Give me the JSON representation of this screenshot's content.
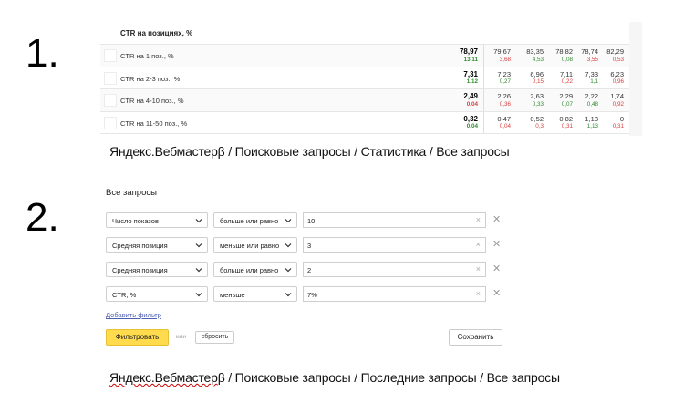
{
  "step_labels": [
    "1.",
    "2."
  ],
  "ctr_table": {
    "title": "CTR на позициях, %",
    "rows": [
      {
        "label": "CTR на 1 поз., %",
        "current": {
          "value": "78,97",
          "delta": "13,11",
          "dir": "up"
        },
        "history": [
          {
            "value": "79,67",
            "delta": "3,68",
            "dir": "down"
          },
          {
            "value": "83,35",
            "delta": "4,53",
            "dir": "up"
          },
          {
            "value": "78,82",
            "delta": "0,08",
            "dir": "up"
          },
          {
            "value": "78,74",
            "delta": "3,55",
            "dir": "down"
          },
          {
            "value": "82,29",
            "delta": "0,53",
            "dir": "down"
          }
        ]
      },
      {
        "label": "CTR на 2-3 поз., %",
        "current": {
          "value": "7,31",
          "delta": "1,12",
          "dir": "up"
        },
        "history": [
          {
            "value": "7,23",
            "delta": "0,27",
            "dir": "up"
          },
          {
            "value": "6,96",
            "delta": "0,15",
            "dir": "down"
          },
          {
            "value": "7,11",
            "delta": "0,22",
            "dir": "down"
          },
          {
            "value": "7,33",
            "delta": "1,1",
            "dir": "up"
          },
          {
            "value": "6,23",
            "delta": "0,96",
            "dir": "down"
          }
        ]
      },
      {
        "label": "CTR на 4-10 поз., %",
        "current": {
          "value": "2,49",
          "delta": "0,04",
          "dir": "down"
        },
        "history": [
          {
            "value": "2,26",
            "delta": "0,36",
            "dir": "down"
          },
          {
            "value": "2,63",
            "delta": "0,33",
            "dir": "up"
          },
          {
            "value": "2,29",
            "delta": "0,07",
            "dir": "up"
          },
          {
            "value": "2,22",
            "delta": "0,48",
            "dir": "up"
          },
          {
            "value": "1,74",
            "delta": "0,92",
            "dir": "down"
          }
        ]
      },
      {
        "label": "CTR на 11-50 поз., %",
        "current": {
          "value": "0,32",
          "delta": "0,04",
          "dir": "up"
        },
        "history": [
          {
            "value": "0,47",
            "delta": "0,04",
            "dir": "down"
          },
          {
            "value": "0,52",
            "delta": "0,3",
            "dir": "down"
          },
          {
            "value": "0,82",
            "delta": "0,31",
            "dir": "down"
          },
          {
            "value": "1,13",
            "delta": "1,13",
            "dir": "up"
          },
          {
            "value": "0",
            "delta": "0,31",
            "dir": "down"
          }
        ]
      }
    ]
  },
  "caption_1": "Яндекс.Вебмастерβ  / Поисковые запросы / Статистика  / Все запросы",
  "filters": {
    "title": "Все запросы",
    "rows": [
      {
        "field": "Число показов",
        "op": "больше или равно",
        "value": "10"
      },
      {
        "field": "Средняя позиция",
        "op": "меньше или равно",
        "value": "3"
      },
      {
        "field": "Средняя позиция",
        "op": "больше или равно",
        "value": "2"
      },
      {
        "field": "CTR, %",
        "op": "меньше",
        "value": "7%"
      }
    ],
    "clear_glyph": "×",
    "remove_glyph": "✕",
    "add_filter_label": "Добавить фильтр",
    "filter_button": "Фильтровать",
    "or_label": "или",
    "reset_button": "сбросить",
    "save_button": "Сохранить"
  },
  "caption_2": {
    "product": "Яндекс.Вебмастер",
    "rest": "β / Поисковые запросы / Последние  запросы / Все запросы"
  },
  "colors": {
    "up": "#2e8b2e",
    "down": "#d94040",
    "accent_button": "#ffdb4d",
    "link": "#4d5fb3"
  }
}
